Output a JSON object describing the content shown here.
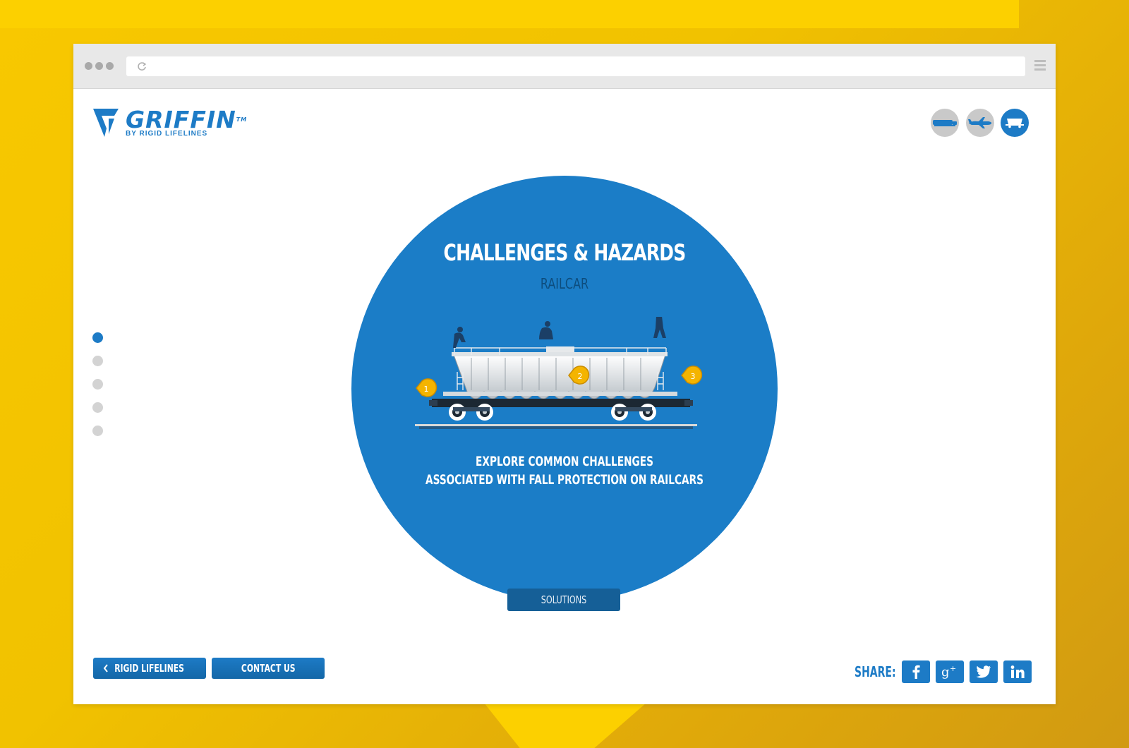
{
  "colors": {
    "brand_blue": "#1d7bc6",
    "circle_blue": "#1b7dc7",
    "dark_blue": "#155f97",
    "subtitle_blue": "#0d4d7e",
    "background_yellow": "#f8c800",
    "inactive_gray": "#c9c9c9"
  },
  "browser": {
    "window_dots_icon": "window-controls-icon",
    "reload_icon": "reload-icon",
    "address_value": "",
    "menu_icon": "hamburger-menu-icon"
  },
  "logo": {
    "word": "GRIFFIN",
    "trademark": "TM",
    "tagline": "BY RIGID LIFELINES"
  },
  "mode_buttons": [
    {
      "icon": "truck-icon",
      "active": false
    },
    {
      "icon": "airplane-icon",
      "active": false
    },
    {
      "icon": "railcar-icon",
      "active": true
    }
  ],
  "section_nav": {
    "count": 5,
    "active_index": 0
  },
  "hero": {
    "title": "CHALLENGES & HAZARDS",
    "subtitle": "RAILCAR",
    "markers": [
      "1",
      "2",
      "3"
    ],
    "description_line1": "EXPLORE COMMON CHALLENGES",
    "description_line2": "ASSOCIATED WITH FALL PROTECTION ON RAILCARS",
    "cta_label": "SOLUTIONS"
  },
  "footer": {
    "back_button": "RIGID LIFELINES",
    "contact_button": "CONTACT US",
    "share_label": "SHARE:",
    "social": [
      "facebook-icon",
      "google-plus-icon",
      "twitter-icon",
      "linkedin-icon"
    ]
  }
}
